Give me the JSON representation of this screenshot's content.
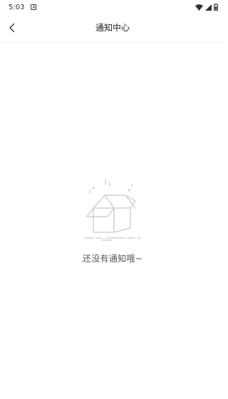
{
  "status_bar": {
    "time": "5:03",
    "notification_icon": "a-badge-icon",
    "icons": [
      "wifi-icon",
      "cellular-signal-icon",
      "battery-icon"
    ]
  },
  "nav": {
    "back_icon": "chevron-left-icon",
    "title": "通知中心"
  },
  "empty_state": {
    "icon": "empty-box-icon",
    "message": "还没有通知哦~"
  },
  "colors": {
    "background": "#ffffff",
    "title_text": "#222222",
    "empty_text": "#555555",
    "illustration": "#c8c8c8"
  }
}
